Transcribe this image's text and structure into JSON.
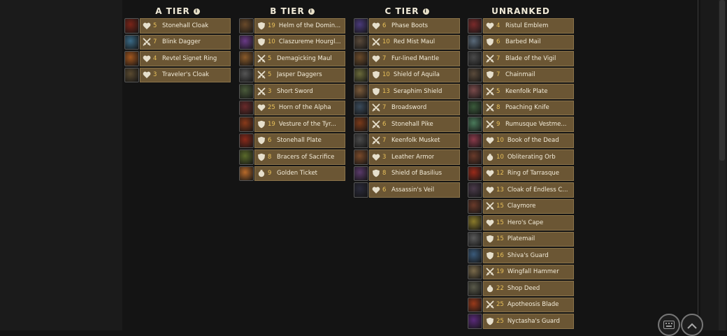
{
  "tiers": {
    "a": {
      "label": "A TIER",
      "info": "i"
    },
    "b": {
      "label": "B TIER",
      "info": "i"
    },
    "c": {
      "label": "C TIER",
      "info": "i"
    },
    "u": {
      "label": "UNRANKED"
    }
  },
  "a_items": [
    {
      "role": "heart",
      "num": "5",
      "name": "Stonehall Cloak",
      "color": "#7a2418"
    },
    {
      "role": "sword",
      "num": "7",
      "name": "Blink Dagger",
      "color": "#3a6a86"
    },
    {
      "role": "heart",
      "num": "4",
      "name": "Revtel Signet Ring",
      "color": "#a2561e"
    },
    {
      "role": "heart",
      "num": "3",
      "name": "Traveler's Cloak",
      "color": "#5a4a30"
    }
  ],
  "b_items": [
    {
      "role": "shield",
      "num": "19",
      "name": "Helm of the Domin...",
      "color": "#6a4a2a"
    },
    {
      "role": "shield",
      "num": "10",
      "name": "Claszureme Hourgl...",
      "color": "#6a3a86"
    },
    {
      "role": "sword",
      "num": "5",
      "name": "Demagicking Maul",
      "color": "#8a5a2a"
    },
    {
      "role": "sword",
      "num": "5",
      "name": "Jasper Daggers",
      "color": "#555"
    },
    {
      "role": "sword",
      "num": "3",
      "name": "Short Sword",
      "color": "#4a5a3a"
    },
    {
      "role": "heart",
      "num": "25",
      "name": "Horn of the Alpha",
      "color": "#6a2a2a"
    },
    {
      "role": "shield",
      "num": "19",
      "name": "Vesture of the Tyr...",
      "color": "#8a3a1a"
    },
    {
      "role": "shield",
      "num": "6",
      "name": "Stonehall Plate",
      "color": "#8a2a1a"
    },
    {
      "role": "shield",
      "num": "8",
      "name": "Bracers of Sacrifice",
      "color": "#5a6a2a"
    },
    {
      "role": "gold",
      "num": "9",
      "name": "Golden Ticket",
      "color": "#b86a2a"
    }
  ],
  "c_items": [
    {
      "role": "heart",
      "num": "6",
      "name": "Phase Boots",
      "color": "#4a3a7a"
    },
    {
      "role": "sword",
      "num": "10",
      "name": "Red Mist Maul",
      "color": "#5a4a3a"
    },
    {
      "role": "heart",
      "num": "7",
      "name": "Fur-lined Mantle",
      "color": "#6a4a2a"
    },
    {
      "role": "shield",
      "num": "10",
      "name": "Shield of Aquila",
      "color": "#6a6a3a"
    },
    {
      "role": "shield",
      "num": "13",
      "name": "Seraphim Shield",
      "color": "#7a5a3a"
    },
    {
      "role": "sword",
      "num": "7",
      "name": "Broadsword",
      "color": "#3a4a5a"
    },
    {
      "role": "sword",
      "num": "6",
      "name": "Stonehall Pike",
      "color": "#7a3a1a"
    },
    {
      "role": "sword",
      "num": "7",
      "name": "Keenfolk Musket",
      "color": "#4a4a4a"
    },
    {
      "role": "heart",
      "num": "3",
      "name": "Leather Armor",
      "color": "#7a4a2a"
    },
    {
      "role": "shield",
      "num": "8",
      "name": "Shield of Basilius",
      "color": "#5a3a6a"
    },
    {
      "role": "heart",
      "num": "6",
      "name": "Assassin's Veil",
      "color": "#2a2a3a"
    }
  ],
  "u_items": [
    {
      "role": "heart",
      "num": "4",
      "name": "Ristul Emblem",
      "color": "#7a2a2a"
    },
    {
      "role": "shield",
      "num": "6",
      "name": "Barbed Mail",
      "color": "#5a6a7a"
    },
    {
      "role": "sword",
      "num": "7",
      "name": "Blade of the Vigil",
      "color": "#4a4a4a"
    },
    {
      "role": "shield",
      "num": "7",
      "name": "Chainmail",
      "color": "#5a4a3a"
    },
    {
      "role": "sword",
      "num": "5",
      "name": "Keenfolk Plate",
      "color": "#7a4a4a"
    },
    {
      "role": "sword",
      "num": "8",
      "name": "Poaching Knife",
      "color": "#3a5a3a"
    },
    {
      "role": "sword",
      "num": "9",
      "name": "Rumusque Vestme...",
      "color": "#4a7a5a"
    },
    {
      "role": "heart",
      "num": "10",
      "name": "Book of the Dead",
      "color": "#8a3a4a"
    },
    {
      "role": "gold",
      "num": "10",
      "name": "Obliterating Orb",
      "color": "#6a3a2a"
    },
    {
      "role": "heart",
      "num": "12",
      "name": "Ring of Tarrasque",
      "color": "#9a2a1a"
    },
    {
      "role": "heart",
      "num": "13",
      "name": "Cloak of Endless C...",
      "color": "#4a3a4a"
    },
    {
      "role": "sword",
      "num": "15",
      "name": "Claymore",
      "color": "#6a3a2a"
    },
    {
      "role": "heart",
      "num": "15",
      "name": "Hero's Cape",
      "color": "#8a7a2a"
    },
    {
      "role": "shield",
      "num": "15",
      "name": "Platemail",
      "color": "#5a5a5a"
    },
    {
      "role": "shield",
      "num": "16",
      "name": "Shiva's Guard",
      "color": "#3a5a7a"
    },
    {
      "role": "sword",
      "num": "19",
      "name": "Wingfall Hammer",
      "color": "#7a6a4a"
    },
    {
      "role": "gold",
      "num": "22",
      "name": "Shop Deed",
      "color": "#5a5a4a"
    },
    {
      "role": "sword",
      "num": "25",
      "name": "Apotheosis Blade",
      "color": "#9a3a1a"
    },
    {
      "role": "shield",
      "num": "25",
      "name": "Nyctasha's Guard",
      "color": "#5a2a7a"
    }
  ],
  "buttons": {
    "keyboard": "keyboard-icon",
    "scroll_top": "chevron-up-icon"
  }
}
